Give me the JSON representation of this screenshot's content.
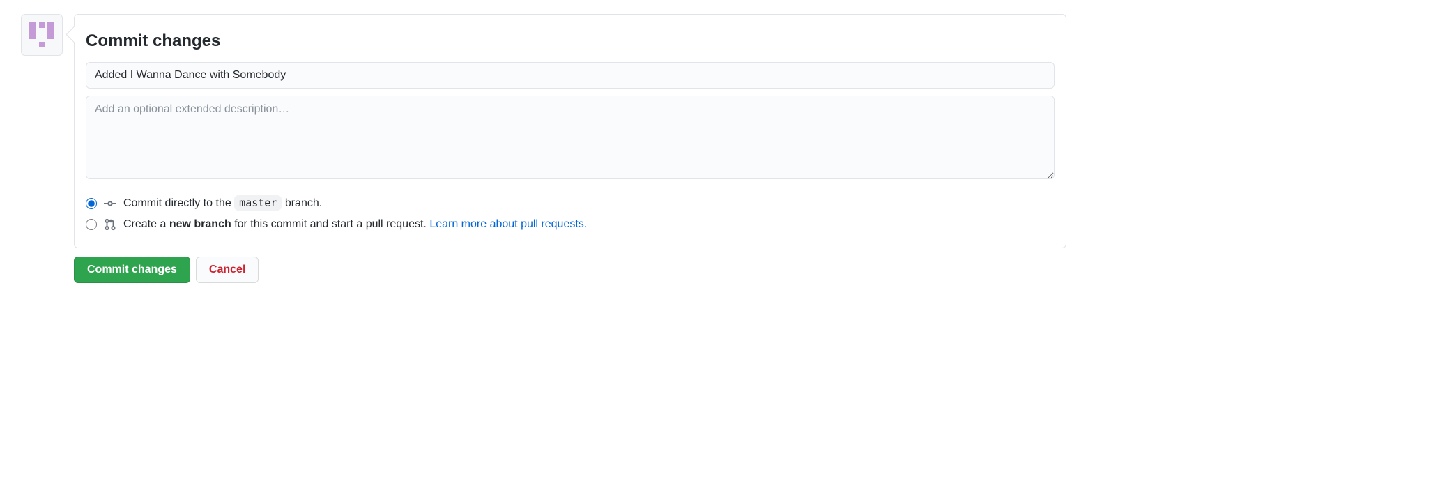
{
  "header": {
    "title": "Commit changes"
  },
  "summary": {
    "value": "Added I Wanna Dance with Somebody"
  },
  "description": {
    "placeholder": "Add an optional extended description…"
  },
  "options": {
    "direct": {
      "prefix": "Commit directly to the",
      "branch": "master",
      "suffix": "branch."
    },
    "newbranch": {
      "prefix": "Create a",
      "bold": "new branch",
      "suffix": "for this commit and start a pull request.",
      "learn": "Learn more about pull requests."
    }
  },
  "actions": {
    "commit": "Commit changes",
    "cancel": "Cancel"
  }
}
